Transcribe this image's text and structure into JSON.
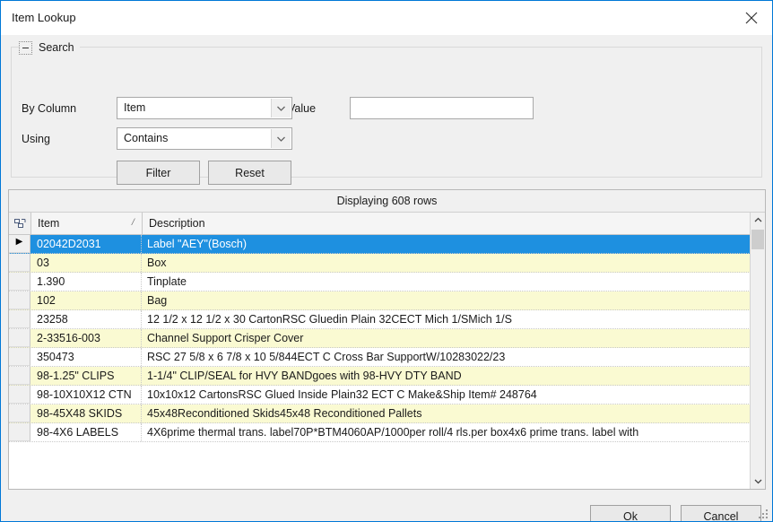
{
  "window": {
    "title": "Item Lookup",
    "close_icon": "close-icon",
    "accent_border": "#0078d7"
  },
  "search": {
    "legend": "Search",
    "collapse_icon": "collapse-minus-icon",
    "by_column_label": "By Column",
    "by_column_value": "Item",
    "using_label": "Using",
    "using_value": "Contains",
    "value_label": "Value",
    "value_text": "",
    "value_placeholder": "",
    "filter_label": "Filter",
    "reset_label": "Reset",
    "dropdown_icon": "chevron-down-icon"
  },
  "grid": {
    "caption": "Displaying 608 rows",
    "corner_icon": "column-selector-icon",
    "sort_indicator": "sort-ascending-icon",
    "row_pointer_icon": "current-row-arrow-icon",
    "columns": [
      "Item",
      "Description"
    ],
    "selection_color": "#1e90e0",
    "alt_row_color": "#fafad2",
    "rows": [
      {
        "item": "02042D2031",
        "description": "Label \"AEY\"(Bosch)"
      },
      {
        "item": "03",
        "description": "Box"
      },
      {
        "item": "1.390",
        "description": "Tinplate"
      },
      {
        "item": "102",
        "description": "Bag"
      },
      {
        "item": "23258",
        "description": "12 1/2 x 12 1/2 x 30 CartonRSC Gluedin Plain 32CECT Mich 1/SMich 1/S"
      },
      {
        "item": "2-33516-003",
        "description": "Channel Support Crisper Cover"
      },
      {
        "item": "350473",
        "description": "RSC 27 5/8 x 6 7/8 x 10 5/844ECT C Cross Bar SupportW/10283022/23"
      },
      {
        "item": "98-1.25\" CLIPS",
        "description": "1-1/4\" CLIP/SEAL for HVY BANDgoes with 98-HVY DTY BAND"
      },
      {
        "item": "98-10X10X12 CTN",
        "description": "10x10x12 CartonsRSC Glued Inside Plain32 ECT C Make&Ship Item# 248764"
      },
      {
        "item": "98-45X48 SKIDS",
        "description": "45x48Reconditioned Skids45x48 Reconditioned Pallets"
      },
      {
        "item": "98-4X6 LABELS",
        "description": "4X6prime thermal trans. label70P*BTM4060AP/1000per roll/4 rls.per box4x6 prime trans. label with"
      }
    ],
    "scrollbar": {
      "up_icon": "scroll-up-arrow-icon",
      "down_icon": "scroll-down-arrow-icon"
    }
  },
  "footer": {
    "ok_label": "Ok",
    "cancel_label": "Cancel",
    "resize_grip_icon": "resize-grip-icon"
  }
}
